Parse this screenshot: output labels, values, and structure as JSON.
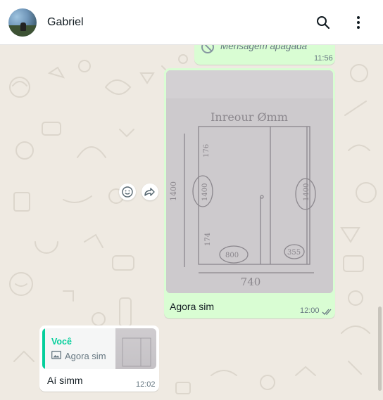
{
  "header": {
    "contact_name": "Gabriel",
    "avatar_icon": "profile-photo",
    "search_icon": "search-icon",
    "menu_icon": "kebab-menu-icon"
  },
  "messages": [
    {
      "type": "deleted",
      "direction": "outgoing",
      "text": "Mensagem apagada",
      "time": "11:56",
      "icon": "ban-icon"
    },
    {
      "type": "image",
      "direction": "outgoing",
      "caption": "Agora sim",
      "time": "12:00",
      "status_icon": "double-check-icon",
      "image_text": {
        "title": "Inreour Ømm",
        "label_left": "1400",
        "label_bottom": "740",
        "labels_inside": [
          "176",
          "1400",
          "1400",
          "174",
          "800",
          "355"
        ]
      },
      "actions": [
        "emoji-react-icon",
        "forward-icon"
      ]
    },
    {
      "type": "reply",
      "direction": "incoming",
      "quote_author": "Você",
      "quote_text": "Agora sim",
      "quote_icon": "image-icon",
      "text": "Aí simm",
      "time": "12:02"
    }
  ],
  "colors": {
    "chat_background": "#efeae2",
    "outgoing_bubble": "#d9fdd3",
    "incoming_bubble": "#ffffff",
    "quote_accent": "#06cf9c",
    "read_ticks": "#667781"
  }
}
